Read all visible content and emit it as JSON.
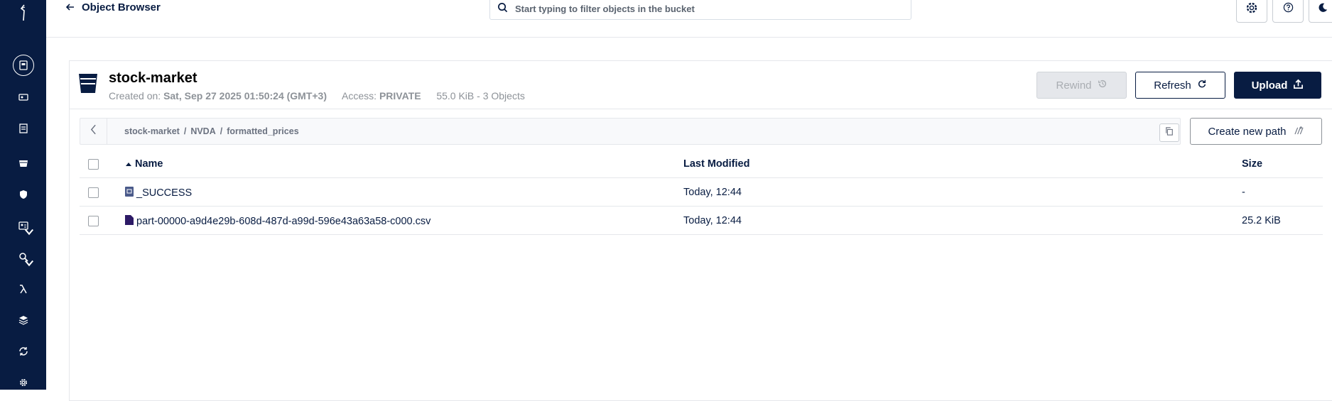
{
  "colors": {
    "navy": "#081c42",
    "muted": "#8d9298",
    "border": "#e5e7eb"
  },
  "sidebar": {
    "icons": [
      "logo-icon",
      "object-browser-icon",
      "access-keys-icon",
      "documentation-icon",
      "buckets-icon",
      "policies-icon",
      "identity-icon",
      "monitoring-icon",
      "events-icon",
      "tiering-icon",
      "site-replication-icon",
      "settings-icon"
    ]
  },
  "header": {
    "back_label": "Object Browser",
    "search_placeholder": "Start typing to filter objects in the bucket"
  },
  "bucket": {
    "name": "stock-market",
    "created_label": "Created on:",
    "created_value": "Sat, Sep 27 2025 01:50:24 (GMT+3)",
    "access_label": "Access:",
    "access_value": "PRIVATE",
    "usage": "55.0 KiB - 3 Objects"
  },
  "actions": {
    "rewind": "Rewind",
    "refresh": "Refresh",
    "upload": "Upload",
    "create_path": "Create new path"
  },
  "breadcrumb": [
    "stock-market",
    "NVDA",
    "formatted_prices"
  ],
  "table": {
    "headers": {
      "name": "Name",
      "modified": "Last Modified",
      "size": "Size"
    },
    "rows": [
      {
        "name": "_SUCCESS",
        "modified": "Today, 12:44",
        "size": "-"
      },
      {
        "name": "part-00000-a9d4e29b-608d-487d-a99d-596e43a63a58-c000.csv",
        "modified": "Today, 12:44",
        "size": "25.2 KiB"
      }
    ]
  }
}
